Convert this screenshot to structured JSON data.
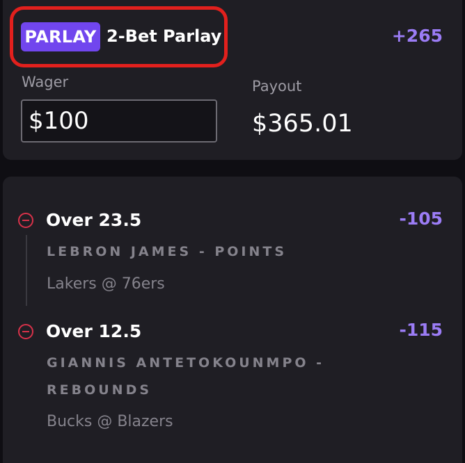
{
  "parlay": {
    "badge": "PARLAY",
    "title": "2-Bet Parlay",
    "odds": "+265",
    "wager_label": "Wager",
    "wager_value": "$100",
    "payout_label": "Payout",
    "payout_value": "$365.01"
  },
  "legs": [
    {
      "selection": "Over 23.5",
      "odds": "-105",
      "market": "LEBRON JAMES - POINTS",
      "game": "Lakers @ 76ers"
    },
    {
      "selection": "Over 12.5",
      "odds": "-115",
      "market": "GIANNIS ANTETOKOUNMPO - REBOUNDS",
      "game": "Bucks @ Blazers"
    }
  ],
  "colors": {
    "accent": "#7146ee",
    "odds": "#9b7cf5",
    "remove": "#d9324a",
    "highlight_outline": "#e2201d",
    "card": "#1f1e24",
    "background": "#0f0e13"
  },
  "icons": {
    "remove": "minus-circle-icon"
  }
}
